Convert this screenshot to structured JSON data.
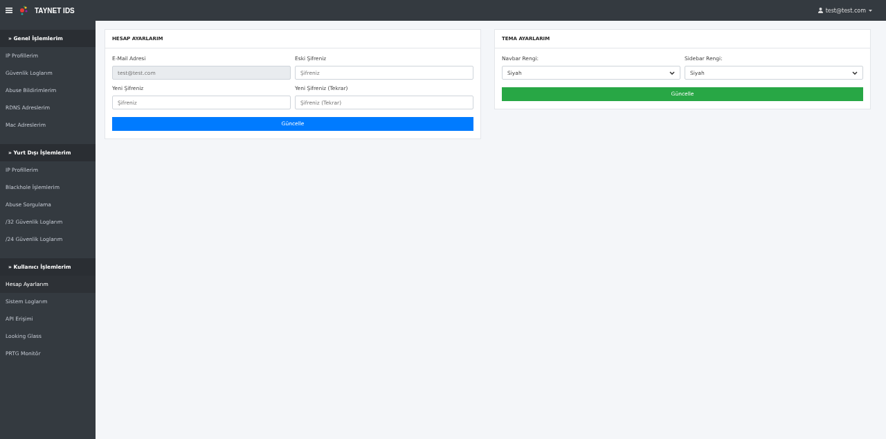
{
  "navbar": {
    "brand": "TAYNET IDS",
    "user": "test@test.com"
  },
  "sidebar": {
    "sections": [
      {
        "title": "» Genel İşlemlerim",
        "items": [
          {
            "label": "IP Profillerim",
            "selected": false
          },
          {
            "label": "Güvenlik Loglarım",
            "selected": false
          },
          {
            "label": "Abuse Bildirimlerim",
            "selected": false
          },
          {
            "label": "RDNS Adreslerim",
            "selected": false
          },
          {
            "label": "Mac Adreslerim",
            "selected": false
          }
        ]
      },
      {
        "title": "» Yurt Dışı İşlemlerim",
        "items": [
          {
            "label": "IP Profillerim",
            "selected": false
          },
          {
            "label": "Blackhole İşlemlerim",
            "selected": false
          },
          {
            "label": "Abuse Sorgulama",
            "selected": false
          },
          {
            "label": "/32 Güvenlik Loglarım",
            "selected": false
          },
          {
            "label": "/24 Güvenlik Loglarım",
            "selected": false
          }
        ]
      },
      {
        "title": "» Kullanıcı İşlemlerim",
        "items": [
          {
            "label": "Hesap Ayarlarım",
            "selected": true
          },
          {
            "label": "Sistem Loglarım",
            "selected": false
          },
          {
            "label": "API Erişimi",
            "selected": false
          },
          {
            "label": "Looking Glass",
            "selected": false
          },
          {
            "label": "PRTG Monitör",
            "selected": false
          }
        ]
      }
    ]
  },
  "cards": [
    {
      "title": "HESAP AYARLARIM",
      "fields": [
        {
          "kind": "input",
          "label": "E-Mail Adresi",
          "value": "test@test.com",
          "disabled": true
        },
        {
          "kind": "input",
          "label": "Eski Şifreniz",
          "placeholder": "Şifreniz",
          "disabled": false
        },
        {
          "kind": "input",
          "label": "Yeni Şifreniz",
          "placeholder": "Şifreniz",
          "disabled": false
        },
        {
          "kind": "input",
          "label": "Yeni Şifreniz (Tekrar)",
          "placeholder": "Şifreniz (Tekrar)",
          "disabled": false
        }
      ],
      "button": {
        "label": "Güncelle",
        "kind": "primary"
      }
    },
    {
      "title": "TEMA AYARLARIM",
      "fields": [
        {
          "kind": "select",
          "label": "Navbar Rengi:",
          "value": "Siyah"
        },
        {
          "kind": "select",
          "label": "Sidebar Rengi:",
          "value": "Siyah"
        }
      ],
      "button": {
        "label": "Güncelle",
        "kind": "success"
      }
    }
  ]
}
